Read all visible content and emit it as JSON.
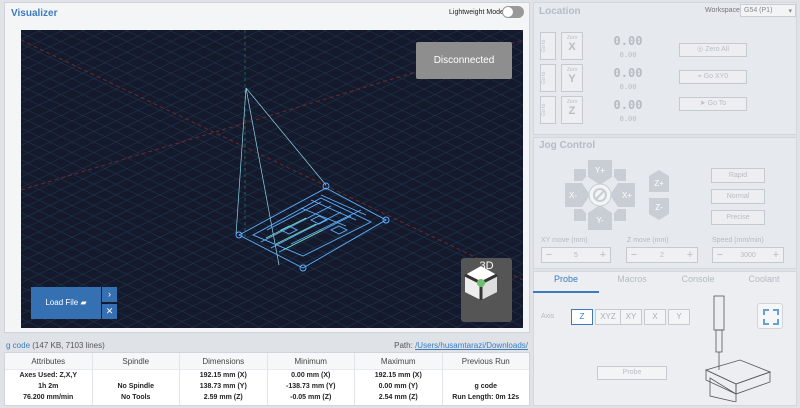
{
  "visualizer": {
    "title": "Visualizer",
    "lightweight_mode_label": "Lightweight Mode",
    "status_overlay": "Disconnected",
    "view_label": "3D",
    "load_file_label": "Load File"
  },
  "gcode": {
    "label": "g code",
    "info": "(147 KB, 7103 lines)",
    "path_prefix": "Path:",
    "path": "/Users/husamtarazi/Downloads/",
    "columns": [
      {
        "header": "Attributes",
        "lines": [
          "Axes Used: Z,X,Y",
          "1h 2m",
          "76.200 mm/min"
        ]
      },
      {
        "header": "Spindle",
        "lines": [
          "",
          "No Spindle",
          "No Tools"
        ]
      },
      {
        "header": "Dimensions",
        "lines": [
          "192.15 mm (X)",
          "138.73 mm (Y)",
          "2.59 mm (Z)"
        ]
      },
      {
        "header": "Minimum",
        "lines": [
          "0.00 mm (X)",
          "-138.73 mm (Y)",
          "-0.05 mm (Z)"
        ]
      },
      {
        "header": "Maximum",
        "lines": [
          "192.15 mm (X)",
          "0.00 mm (Y)",
          "2.54 mm (Z)"
        ]
      },
      {
        "header": "Previous Run",
        "lines": [
          "",
          "g code",
          "Run Length: 0m 12s"
        ]
      }
    ]
  },
  "location": {
    "title": "Location",
    "workspace_label": "Workspace:",
    "workspace_value": "G54 (P1)",
    "goto_label": "Go to",
    "zero_label": "Zero",
    "axes": [
      {
        "axis": "X",
        "value": "0.00",
        "sub": "0.00"
      },
      {
        "axis": "Y",
        "value": "0.00",
        "sub": "0.00"
      },
      {
        "axis": "Z",
        "value": "0.00",
        "sub": "0.00"
      }
    ],
    "buttons": [
      "Zero All",
      "Go XY0",
      "Go To"
    ]
  },
  "jog": {
    "title": "Jog Control",
    "labels": {
      "y_plus": "Y+",
      "y_minus": "Y-",
      "x_plus": "X+",
      "x_minus": "X-",
      "z_plus": "Z+",
      "z_minus": "Z-"
    },
    "speed_buttons": [
      "Rapid",
      "Normal",
      "Precise"
    ],
    "xy_move_label": "XY move (mm)",
    "z_move_label": "Z move (mm)",
    "speed_label": "Speed (mm/min)",
    "xy_move": "5",
    "z_move": "2",
    "speed": "3000"
  },
  "probe": {
    "tabs": [
      "Probe",
      "Macros",
      "Console",
      "Coolant"
    ],
    "axis_label": "Axis",
    "axis_options": [
      "Z",
      "XYZ",
      "XY",
      "X",
      "Y"
    ],
    "selected_axis": "Z",
    "probe_button": "Probe"
  },
  "colors": {
    "accent": "#3b7bbf",
    "canvas_bg": "#141a2b",
    "grid": "#223a55"
  }
}
